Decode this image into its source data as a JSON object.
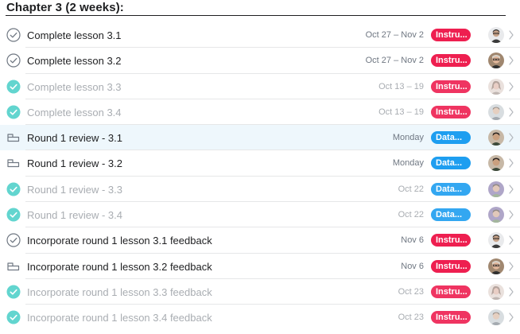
{
  "section": {
    "title": "Chapter 3 (2 weeks):"
  },
  "colors": {
    "instructional": "#ee1f50",
    "data": "#1e9ef0",
    "check_done": "#62d5cf",
    "check_incomplete": "#6f7782"
  },
  "tasks": [
    {
      "name": "Complete lesson 3.1",
      "due": "Oct 27 – Nov 2",
      "tag": "Instru...",
      "tag_type": "instructional",
      "status": "incomplete",
      "icon": "check-circle-icon",
      "avatar": "avatar-a"
    },
    {
      "name": "Complete lesson 3.2",
      "due": "Oct 27 – Nov 2",
      "tag": "Instru...",
      "tag_type": "instructional",
      "status": "incomplete",
      "icon": "check-circle-icon",
      "avatar": "avatar-b"
    },
    {
      "name": "Complete lesson 3.3",
      "due": "Oct 13 – 19",
      "tag": "Instru...",
      "tag_type": "instructional",
      "status": "done",
      "icon": "check-circle-filled-icon",
      "avatar": "avatar-c"
    },
    {
      "name": "Complete lesson 3.4",
      "due": "Oct 13 – 19",
      "tag": "Instru...",
      "tag_type": "instructional",
      "status": "done",
      "icon": "check-circle-filled-icon",
      "avatar": "avatar-d"
    },
    {
      "name": "Round 1 review - 3.1",
      "due": "Monday",
      "tag": "Data...",
      "tag_type": "data",
      "status": "approval",
      "icon": "approval-icon",
      "avatar": "avatar-e",
      "highlight": true
    },
    {
      "name": "Round 1 review - 3.2",
      "due": "Monday",
      "tag": "Data...",
      "tag_type": "data",
      "status": "approval",
      "icon": "approval-icon",
      "avatar": "avatar-e"
    },
    {
      "name": "Round 1 review - 3.3",
      "due": "Oct 22",
      "tag": "Data...",
      "tag_type": "data",
      "status": "done",
      "icon": "check-circle-filled-icon",
      "avatar": "avatar-f"
    },
    {
      "name": "Round 1 review - 3.4",
      "due": "Oct 22",
      "tag": "Data...",
      "tag_type": "data",
      "status": "done",
      "icon": "check-circle-filled-icon",
      "avatar": "avatar-f"
    },
    {
      "name": "Incorporate round 1 lesson 3.1 feedback",
      "due": "Nov 6",
      "tag": "Instru...",
      "tag_type": "instructional",
      "status": "incomplete",
      "icon": "check-circle-icon",
      "avatar": "avatar-a"
    },
    {
      "name": "Incorporate round 1 lesson 3.2 feedback",
      "due": "Nov 6",
      "tag": "Instru...",
      "tag_type": "instructional",
      "status": "approval",
      "icon": "approval-icon",
      "avatar": "avatar-b"
    },
    {
      "name": "Incorporate round 1 lesson 3.3 feedback",
      "due": "Oct 23",
      "tag": "Instru...",
      "tag_type": "instructional",
      "status": "done",
      "icon": "check-circle-filled-icon",
      "avatar": "avatar-c"
    },
    {
      "name": "Incorporate round 1 lesson 3.4 feedback",
      "due": "Oct 23",
      "tag": "Instru...",
      "tag_type": "instructional",
      "status": "done",
      "icon": "check-circle-filled-icon",
      "avatar": "avatar-d"
    }
  ]
}
